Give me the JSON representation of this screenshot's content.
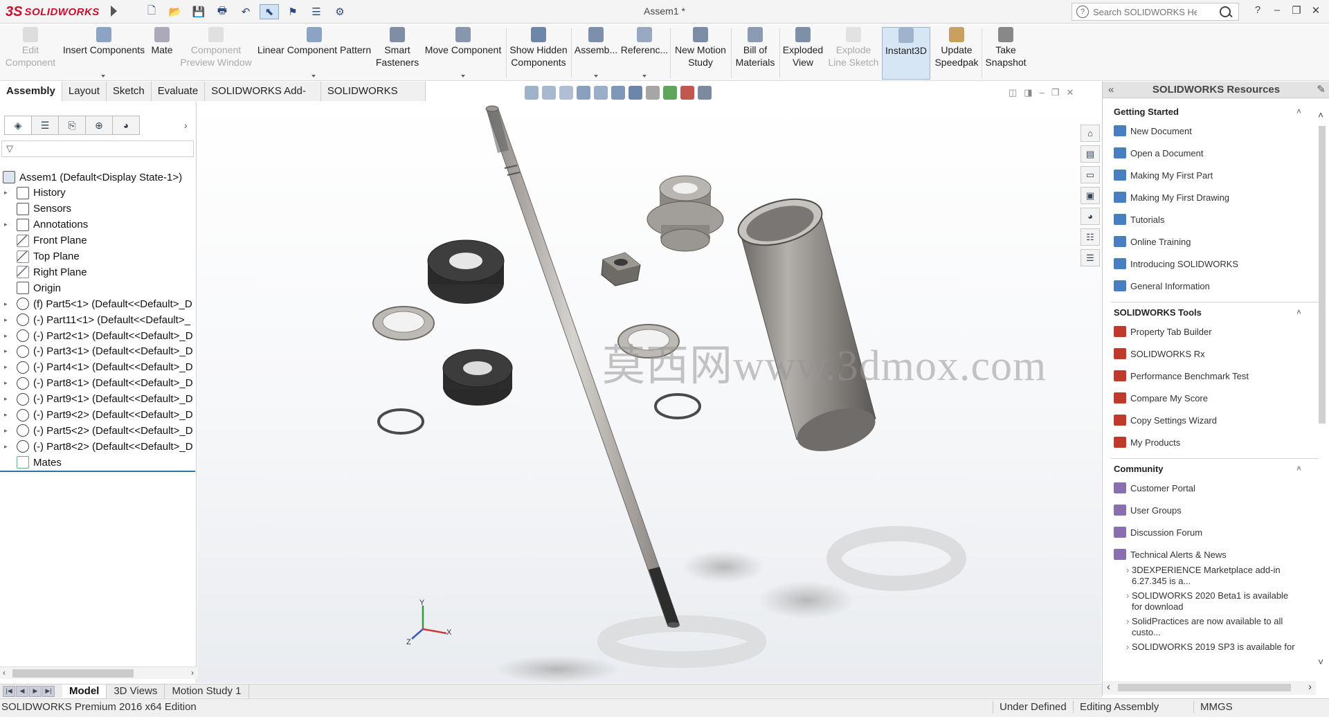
{
  "app": {
    "brand_prefix": "3S",
    "brand_name": "SOLIDWORKS",
    "document_title": "Assem1 *"
  },
  "quick_access": [
    {
      "name": "new-document-icon",
      "glyph": "🗋"
    },
    {
      "name": "open-document-icon",
      "glyph": "📂"
    },
    {
      "name": "save-icon",
      "glyph": "💾"
    },
    {
      "name": "print-icon",
      "glyph": "🖶"
    },
    {
      "name": "undo-icon",
      "glyph": "↶"
    },
    {
      "name": "select-icon",
      "glyph": "⬉"
    },
    {
      "name": "rebuild-icon",
      "glyph": "⚑"
    },
    {
      "name": "file-properties-icon",
      "glyph": "☰"
    },
    {
      "name": "options-icon",
      "glyph": "⚙"
    }
  ],
  "search": {
    "placeholder": "Search SOLIDWORKS Help",
    "help_glyph": "?"
  },
  "window_controls": {
    "help": "?",
    "minimize": "–",
    "restore": "❐",
    "close": "✕"
  },
  "ribbon": {
    "edit_component": "Edit\nComponent",
    "insert_components": "Insert Components",
    "mate": "Mate",
    "component_preview": "Component\nPreview Window",
    "linear_pattern": "Linear Component Pattern",
    "smart_fasteners": "Smart\nFasteners",
    "move_component": "Move Component",
    "show_hidden": "Show Hidden\nComponents",
    "assembly_features": "Assemb...",
    "reference_geometry": "Referenc...",
    "new_motion_study": "New Motion\nStudy",
    "bill_of_materials": "Bill of\nMaterials",
    "exploded_view": "Exploded\nView",
    "explode_line_sketch": "Explode\nLine Sketch",
    "instant3d": "Instant3D",
    "update_speedpak": "Update\nSpeedpak",
    "take_snapshot": "Take\nSnapshot"
  },
  "cm_tabs": [
    "Assembly",
    "Layout",
    "Sketch",
    "Evaluate",
    "SOLIDWORKS Add-Ins",
    "SOLIDWORKS MBD"
  ],
  "feature_manager": {
    "filter_glyph": "▽",
    "tree": [
      {
        "label": "Assem1  (Default<Display State-1>)",
        "kind": "root",
        "expandable": false
      },
      {
        "label": "History",
        "kind": "folder",
        "expandable": true
      },
      {
        "label": "Sensors",
        "kind": "folder",
        "expandable": false
      },
      {
        "label": "Annotations",
        "kind": "folder",
        "expandable": true
      },
      {
        "label": "Front Plane",
        "kind": "plane",
        "expandable": false
      },
      {
        "label": "Top Plane",
        "kind": "plane",
        "expandable": false
      },
      {
        "label": "Right Plane",
        "kind": "plane",
        "expandable": false
      },
      {
        "label": "Origin",
        "kind": "origin",
        "expandable": false
      },
      {
        "label": "(f) Part5<1> (Default<<Default>_D",
        "kind": "part",
        "expandable": true
      },
      {
        "label": "(-) Part11<1> (Default<<Default>_",
        "kind": "part",
        "expandable": true
      },
      {
        "label": "(-) Part2<1> (Default<<Default>_D",
        "kind": "part",
        "expandable": true
      },
      {
        "label": "(-) Part3<1> (Default<<Default>_D",
        "kind": "part",
        "expandable": true
      },
      {
        "label": "(-) Part4<1> (Default<<Default>_D",
        "kind": "part",
        "expandable": true
      },
      {
        "label": "(-) Part8<1> (Default<<Default>_D",
        "kind": "part",
        "expandable": true
      },
      {
        "label": "(-) Part9<1> (Default<<Default>_D",
        "kind": "part",
        "expandable": true
      },
      {
        "label": "(-) Part9<2> (Default<<Default>_D",
        "kind": "part",
        "expandable": true
      },
      {
        "label": "(-) Part5<2> (Default<<Default>_D",
        "kind": "part",
        "expandable": true
      },
      {
        "label": "(-) Part8<2> (Default<<Default>_D",
        "kind": "part",
        "expandable": true
      },
      {
        "label": "Mates",
        "kind": "mates",
        "expandable": false
      }
    ]
  },
  "graphics": {
    "watermark": "莫西网www.3dmox.com",
    "triad": {
      "x": "X",
      "y": "Y",
      "z": "Z"
    }
  },
  "resources": {
    "title": "SOLIDWORKS Resources",
    "getting_started": {
      "title": "Getting Started",
      "items": [
        "New Document",
        "Open a Document",
        "Making My First Part",
        "Making My First Drawing",
        "Tutorials",
        "Online Training",
        "Introducing SOLIDWORKS",
        "General Information"
      ]
    },
    "tools": {
      "title": "SOLIDWORKS Tools",
      "items": [
        "Property Tab Builder",
        "SOLIDWORKS Rx",
        "Performance Benchmark Test",
        "Compare My Score",
        "Copy Settings Wizard",
        "My Products"
      ]
    },
    "community": {
      "title": "Community",
      "items": [
        "Customer Portal",
        "User Groups",
        "Discussion Forum",
        "Technical Alerts & News"
      ]
    },
    "news": [
      "3DEXPERIENCE Marketplace add-in 6.27.345 is a...",
      "SOLIDWORKS 2020 Beta1 is available for download",
      "SolidPractices are now available to all custo...",
      "SOLIDWORKS 2019 SP3 is available for"
    ]
  },
  "bottom_tabs": [
    "Model",
    "3D Views",
    "Motion Study 1"
  ],
  "status": {
    "edition": "SOLIDWORKS Premium 2016 x64 Edition",
    "defined": "Under Defined",
    "editing": "Editing Assembly",
    "units": "MMGS"
  },
  "colors": {
    "brand": "#c8102e",
    "accent": "#2d6fb0",
    "part_dark": "#3a3a3a",
    "part_light": "#b9b6b2"
  }
}
